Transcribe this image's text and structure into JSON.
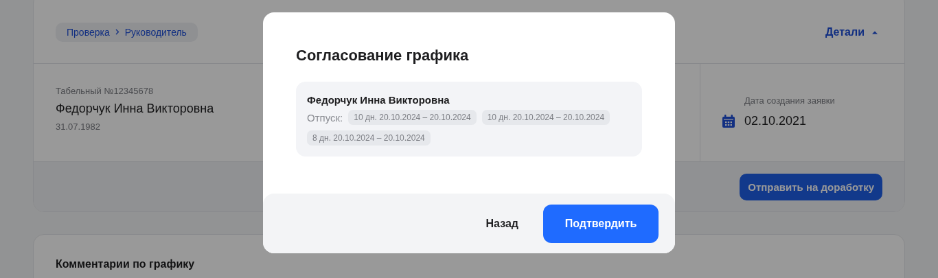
{
  "breadcrumb": [
    {
      "label": "Проверка"
    },
    {
      "label": "Руководитель"
    }
  ],
  "details_toggle": {
    "label": "Детали",
    "expanded": true
  },
  "employee": {
    "personnel_number": "Табельный №12345678",
    "name": "Федорчук Инна Викторовна",
    "birth_date": "31.07.1982"
  },
  "request_date": {
    "label": "Дата создания заявки",
    "value": "02.10.2021"
  },
  "rework_button": "Отправить на доработку",
  "comments": {
    "title": "Комментарии по графику"
  },
  "modal": {
    "title": "Согласование графика",
    "person": "Федорчук Инна Викторовна",
    "vacation_label": "Отпуск:",
    "periods": [
      "10 дн. 20.10.2024 – 20.10.2024",
      "10 дн. 20.10.2024 – 20.10.2024",
      "8 дн. 20.10.2024 – 20.10.2024"
    ],
    "buttons": [
      {
        "label": "Назад",
        "kind": "secondary"
      },
      {
        "label": "Подтвердить",
        "kind": "primary"
      }
    ]
  }
}
